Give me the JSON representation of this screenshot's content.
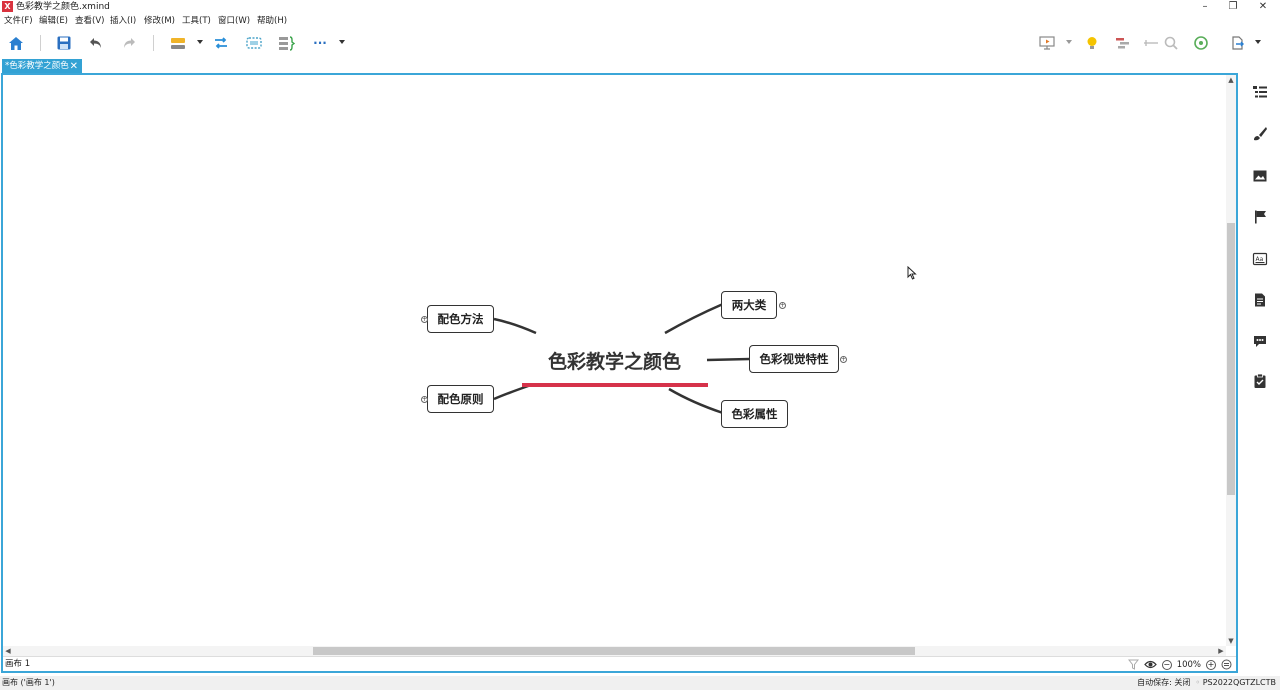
{
  "window": {
    "title": "色彩教学之颜色.xmind",
    "app_logo": "X",
    "controls": {
      "minimize": "–",
      "maximize": "❐",
      "close": "✕"
    }
  },
  "menu": [
    "文件(F)",
    "编辑(E)",
    "查看(V)",
    "插入(I)",
    "修改(M)",
    "工具(T)",
    "窗口(W)",
    "帮助(H)"
  ],
  "toolbar": {
    "icons": [
      "home-icon",
      "save-icon",
      "undo-icon",
      "redo-icon",
      "topic-icon",
      "relationship-icon",
      "boundary-icon",
      "summary-icon",
      "more-icon"
    ],
    "more_label": "···"
  },
  "tab": {
    "label": "*色彩教学之颜色",
    "close": "✕"
  },
  "mindmap": {
    "central": "色彩教学之颜色",
    "accent_color": "#d6324a",
    "topics": {
      "left_top": "配色方法",
      "left_bottom": "配色原则",
      "right_1": "两大类",
      "right_2": "色彩视觉特性",
      "right_3": "色彩属性"
    },
    "expander_symbol": "+"
  },
  "sheet": {
    "tab_label": "画布 1",
    "zoom": "100%",
    "zoom_out": "−",
    "zoom_in": "+"
  },
  "status": {
    "left": "画布 ('画布 1')",
    "autosave": "自动保存: 关闭",
    "account": "PS2022QGTZLCTB"
  }
}
